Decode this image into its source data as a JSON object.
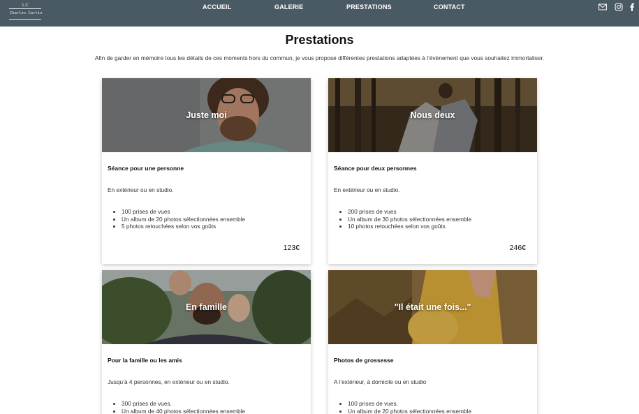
{
  "header": {
    "logo_mono": "LC",
    "logo_name": "Charles Cartin",
    "nav": [
      "ACCUEIL",
      "GALERIE",
      "PRESTATIONS",
      "CONTACT"
    ]
  },
  "icons": [
    "mail-icon",
    "instagram-icon",
    "facebook-icon"
  ],
  "page": {
    "title": "Prestations",
    "intro": "Afin de garder en mémoire tous les détails de ces moments hors du commun, je vous propose différentes prestations adaptées à l’évènement que vous souhaitez immortaliser."
  },
  "cards": [
    {
      "title": "Juste moi",
      "subtitle": "Séance pour une personne",
      "desc": "En extérieur ou en studio.",
      "items": [
        "100 prises de vues",
        "Un album de 20 photos sélectionnées ensemble",
        "5 photos retouchées selon vos goûts"
      ],
      "price": "123€"
    },
    {
      "title": "Nous deux",
      "subtitle": "Séance pour deux personnes",
      "desc": "En extérieur ou en studio.",
      "items": [
        "200 prises de vues",
        "Un album de 30 photos sélectionnées ensemble",
        "10 photos retouchées selon vos goûts"
      ],
      "price": "246€"
    },
    {
      "title": "En famille",
      "subtitle": "Pour la famille ou les amis",
      "desc": "Jusqu’à 4 personnes, en extérieur ou en studio.",
      "items": [
        "300 prises de vues.",
        "Un album de 40 photos sélectionnées ensemble"
      ],
      "price": ""
    },
    {
      "title": "\"Il était une fois...\"",
      "subtitle": "Photos de grossesse",
      "desc": "A l’extérieur, à domicile ou en studio",
      "items": [
        "100 prises de vues.",
        "Un album de 20 photos sélectionnées ensemble"
      ],
      "price": ""
    }
  ],
  "colors": {
    "header_bg": "#4a5a65",
    "text": "#222222"
  }
}
